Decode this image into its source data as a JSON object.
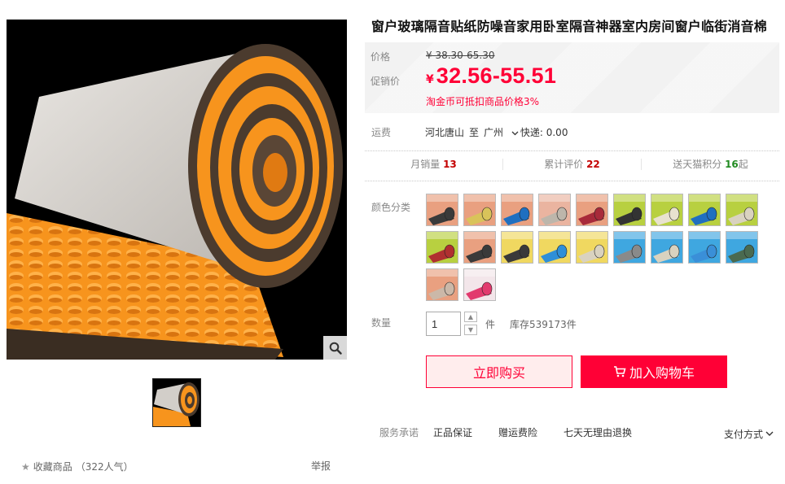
{
  "product": {
    "title": "窗户玻璃隔音贴纸防噪音家用卧室隔音神器室内房间窗户临街消音棉"
  },
  "price": {
    "price_label": "价格",
    "original": "¥ 38.30-65.30",
    "promo_label": "促销价",
    "currency": "¥",
    "promo": "32.56-55.51",
    "coin_note": "淘金币可抵扣商品价格3%"
  },
  "shipping": {
    "label": "运费",
    "from": "河北唐山",
    "to_word": "至",
    "to": "广州",
    "express": "快递: 0.00"
  },
  "stats": {
    "monthly_sales_label": "月销量",
    "monthly_sales": "13",
    "reviews_label": "累计评价",
    "reviews": "22",
    "points_label": "送天猫积分",
    "points": "16",
    "points_suffix": "起"
  },
  "color": {
    "label": "颜色分类",
    "swatch_count": 20
  },
  "quantity": {
    "label": "数量",
    "value": "1",
    "unit": "件",
    "stock": "库存539173件"
  },
  "buttons": {
    "buy_now": "立即购买",
    "add_cart": "加入购物车"
  },
  "service": {
    "label": "服务承诺",
    "items": [
      "正品保证",
      "赠运费险",
      "七天无理由退换"
    ],
    "pay": "支付方式"
  },
  "gallery": {
    "favorite": "收藏商品",
    "popularity": "（322人气）",
    "report": "举报"
  },
  "colors": {
    "accent": "#ff0036",
    "foam_orange": "#f7941d",
    "foam_grey": "#d9d5d0"
  },
  "icons": {
    "zoom": "search-icon",
    "cart": "cart-icon",
    "fav": "star-icon",
    "pay": "chevron-down-icon"
  }
}
